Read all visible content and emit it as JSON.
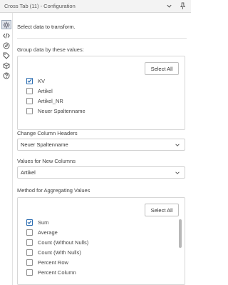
{
  "window": {
    "title": "Cross Tab (11) - Configuration"
  },
  "intro": "Select data to transform.",
  "group_by": {
    "label": "Group data by these values:",
    "select_all": "Select All",
    "items": [
      {
        "label": "KV",
        "checked": true
      },
      {
        "label": "Artikel",
        "checked": false
      },
      {
        "label": "Artikel_NR",
        "checked": false
      },
      {
        "label": "Neuer Spaltenname",
        "checked": false
      }
    ]
  },
  "change_headers": {
    "label": "Change Column Headers",
    "value": "Neuer Spaltenname"
  },
  "values_new_columns": {
    "label": "Values for New Columns",
    "value": "Artikel"
  },
  "aggregation": {
    "label": "Method for Aggregating Values",
    "select_all": "Select All",
    "items": [
      {
        "label": "Sum",
        "checked": true
      },
      {
        "label": "Average",
        "checked": false
      },
      {
        "label": "Count (Without Nulls)",
        "checked": false
      },
      {
        "label": "Count (With Nulls)",
        "checked": false
      },
      {
        "label": "Percent Row",
        "checked": false
      },
      {
        "label": "Percent Column",
        "checked": false
      }
    ]
  },
  "colors": {
    "accent": "#2b6cb0"
  }
}
